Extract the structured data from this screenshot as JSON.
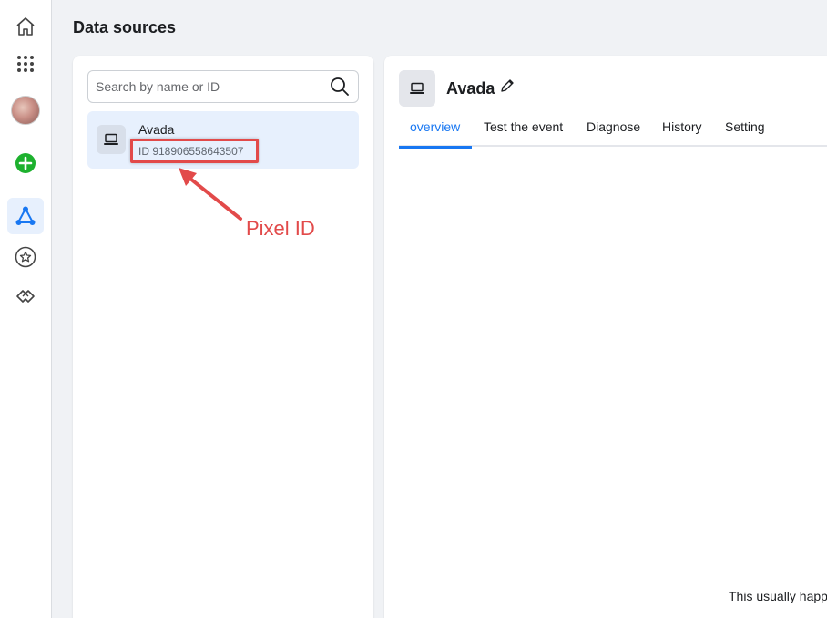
{
  "page": {
    "title": "Data sources"
  },
  "search": {
    "placeholder": "Search by name or ID"
  },
  "sources": [
    {
      "name": "Avada",
      "id": "ID 918906558643507"
    }
  ],
  "annotation": {
    "label": "Pixel ID",
    "color": "#e24a4a"
  },
  "detail": {
    "title": "Avada",
    "tabs": [
      {
        "label": "overview",
        "active": true
      },
      {
        "label": "Test the event"
      },
      {
        "label": "Diagnose"
      },
      {
        "label": "History"
      },
      {
        "label": "Setting"
      }
    ],
    "footer_text": "This usually happ"
  },
  "rail": {
    "items": [
      "home-icon",
      "apps-grid-icon",
      "avatar",
      "create-icon",
      "events-manager-icon",
      "star-icon",
      "partner-handshake-icon"
    ]
  },
  "colors": {
    "accent": "#1877f2",
    "selected_bg": "#e7f0fd",
    "create_green": "#1db12e"
  }
}
